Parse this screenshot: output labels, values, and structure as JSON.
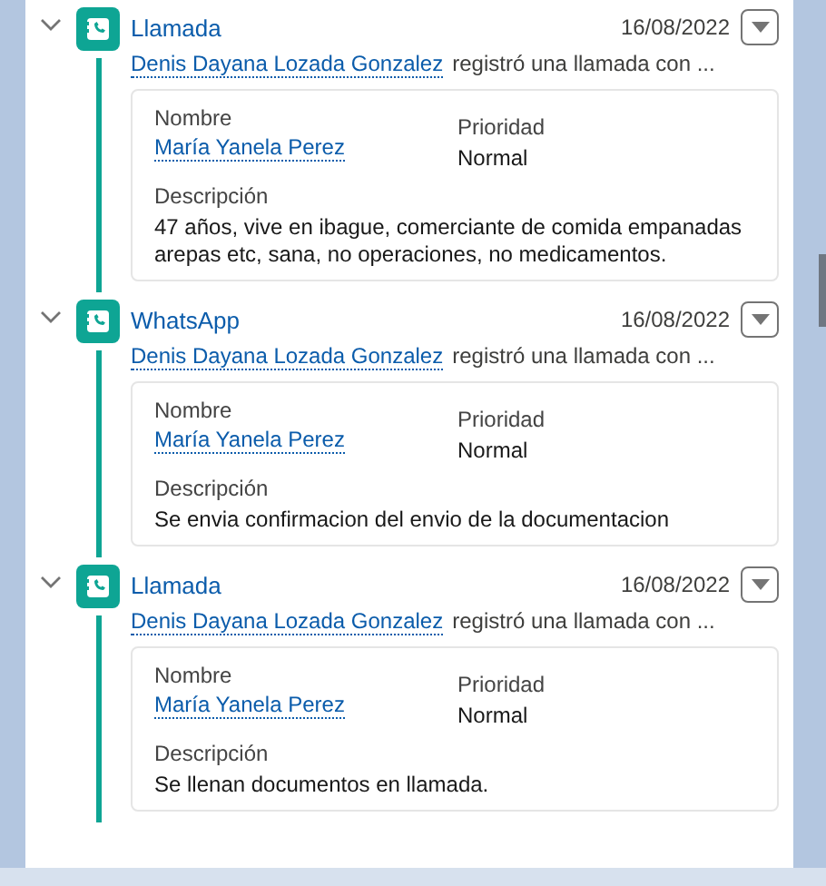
{
  "entries": [
    {
      "expanded": true,
      "title": "Llamada",
      "date": "16/08/2022",
      "actor": "Denis Dayana Lozada Gonzalez",
      "summary": "registró una llamada con ...",
      "name_label": "Nombre",
      "name": "María Yanela Perez",
      "priority_label": "Prioridad",
      "priority": "Normal",
      "description_label": "Descripción",
      "description": "47 años, vive en ibague, comerciante de comida empanadas arepas etc, sana, no operaciones, no medicamentos."
    },
    {
      "expanded": true,
      "title": "WhatsApp",
      "date": "16/08/2022",
      "actor": "Denis Dayana Lozada Gonzalez",
      "summary": "registró una llamada con ...",
      "name_label": "Nombre",
      "name": "María Yanela Perez",
      "priority_label": "Prioridad",
      "priority": "Normal",
      "description_label": "Descripción",
      "description": "Se envia confirmacion del envio de la documentacion"
    },
    {
      "expanded": true,
      "title": "Llamada",
      "date": "16/08/2022",
      "actor": "Denis Dayana Lozada Gonzalez",
      "summary": "registró una llamada con ...",
      "name_label": "Nombre",
      "name": "María Yanela Perez",
      "priority_label": "Prioridad",
      "priority": "Normal",
      "description_label": "Descripción",
      "description": "Se llenan documentos en llamada."
    }
  ]
}
